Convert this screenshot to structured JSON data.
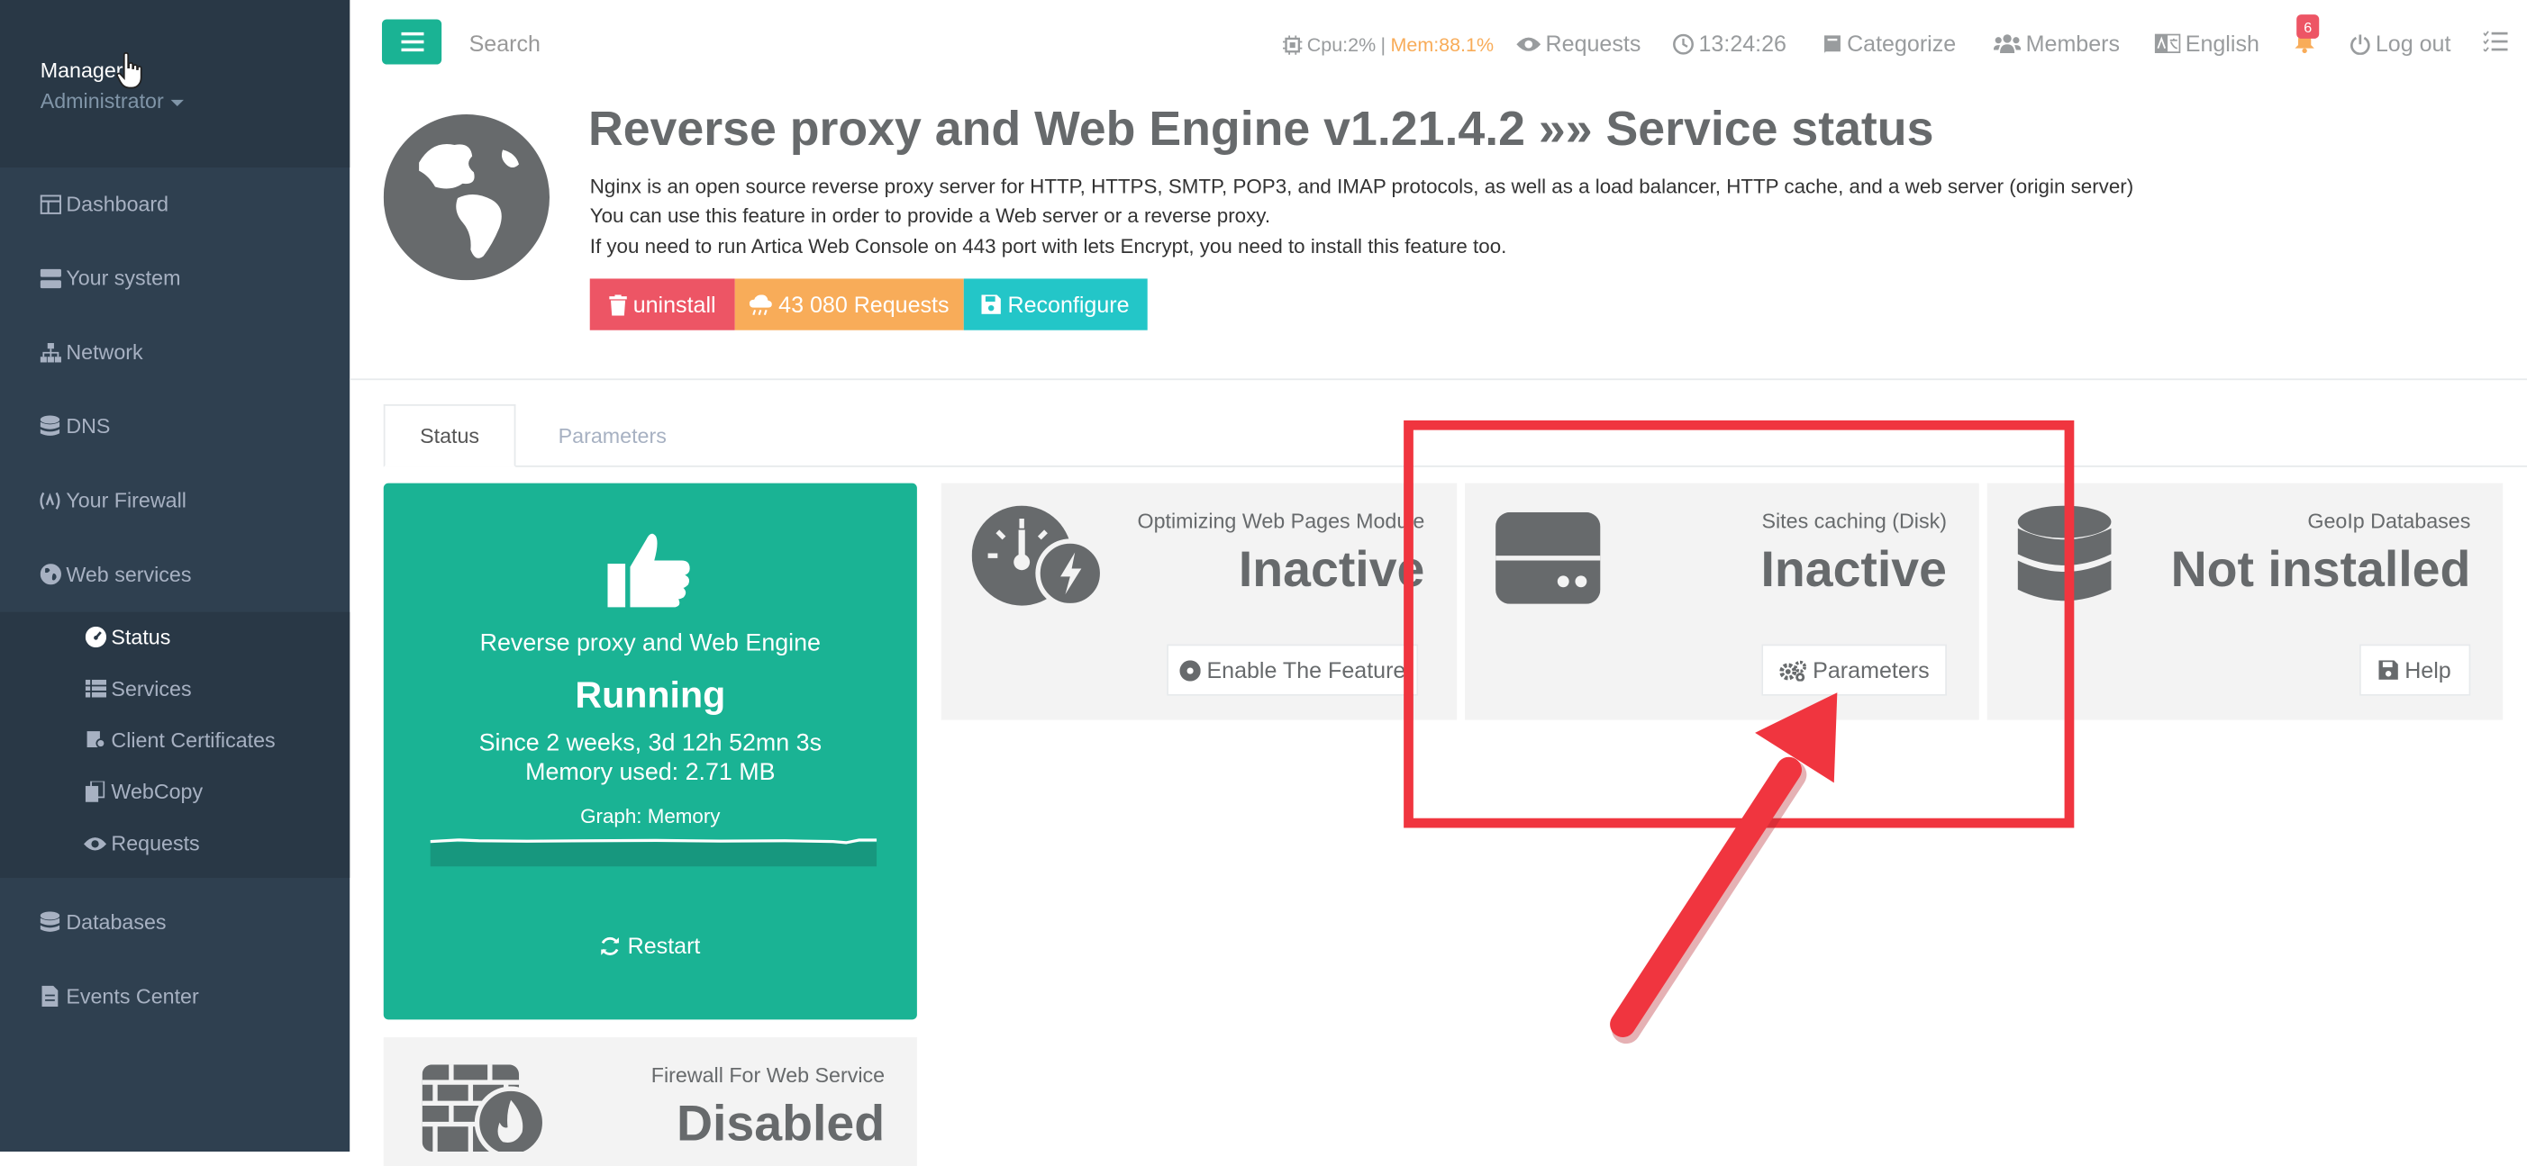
{
  "profile": {
    "name": "Manager",
    "role": "Administrator"
  },
  "sidebar": {
    "items": [
      {
        "label": "Dashboard",
        "icon": "dashboard-icon"
      },
      {
        "label": "Your system",
        "icon": "server-icon"
      },
      {
        "label": "Network",
        "icon": "sitemap-icon"
      },
      {
        "label": "DNS",
        "icon": "database-icon"
      },
      {
        "label": "Your Firewall",
        "icon": "firewall-icon"
      },
      {
        "label": "Web services",
        "icon": "globe-icon"
      },
      {
        "label": "Databases",
        "icon": "database-icon"
      },
      {
        "label": "Events Center",
        "icon": "file-icon"
      }
    ],
    "submenu": [
      {
        "label": "Status",
        "icon": "dashboard-gauge-icon"
      },
      {
        "label": "Services",
        "icon": "list-icon"
      },
      {
        "label": "Client Certificates",
        "icon": "certificate-icon"
      },
      {
        "label": "WebCopy",
        "icon": "copy-icon"
      },
      {
        "label": "Requests",
        "icon": "eye-icon"
      }
    ]
  },
  "topbar": {
    "search_placeholder": "Search",
    "cpu": "Cpu:2%",
    "separator": "|",
    "mem": "Mem:88.1%",
    "requests": "Requests",
    "time": "13:24:26",
    "categorize": "Categorize",
    "members": "Members",
    "language": "English",
    "notifications": "6",
    "logout": "Log out"
  },
  "header": {
    "title": "Reverse proxy and Web Engine v1.21.4.2 »» Service status",
    "desc1": "Nginx is an open source reverse proxy server for HTTP, HTTPS, SMTP, POP3, and IMAP protocols, as well as a load balancer, HTTP cache, and a web server (origin server)",
    "desc2": "You can use this feature in order to provide a Web server or a reverse proxy.",
    "desc3": "If you need to run Artica Web Console on 443 port with lets Encrypt, you need to install this feature too.",
    "uninstall": "uninstall",
    "requests": "43 080 Requests",
    "reconfigure": "Reconfigure"
  },
  "tabs": [
    "Status",
    "Parameters"
  ],
  "service_card": {
    "name": "Reverse proxy and Web Engine",
    "state": "Running",
    "since": "Since 2 weeks, 3d 12h 52mn 3s",
    "memory": "Memory used: 2.71 MB",
    "graph_label": "Graph: Memory",
    "restart": "Restart"
  },
  "widgets": [
    {
      "label": "Optimizing Web Pages Module",
      "value": "Inactive",
      "button": "Enable The Feature"
    },
    {
      "label": "Sites caching (Disk)",
      "value": "Inactive",
      "button": "Parameters"
    },
    {
      "label": "GeoIp Databases",
      "value": "Not installed",
      "button": "Help"
    }
  ],
  "firewall_widget": {
    "label": "Firewall For Web Service",
    "value": "Disabled"
  },
  "colors": {
    "sidebar": "#2f4050",
    "primary": "#1ab394",
    "danger": "#ed5565",
    "warning": "#f8ac59",
    "info": "#23c6c8",
    "annotation": "#f0353f"
  }
}
